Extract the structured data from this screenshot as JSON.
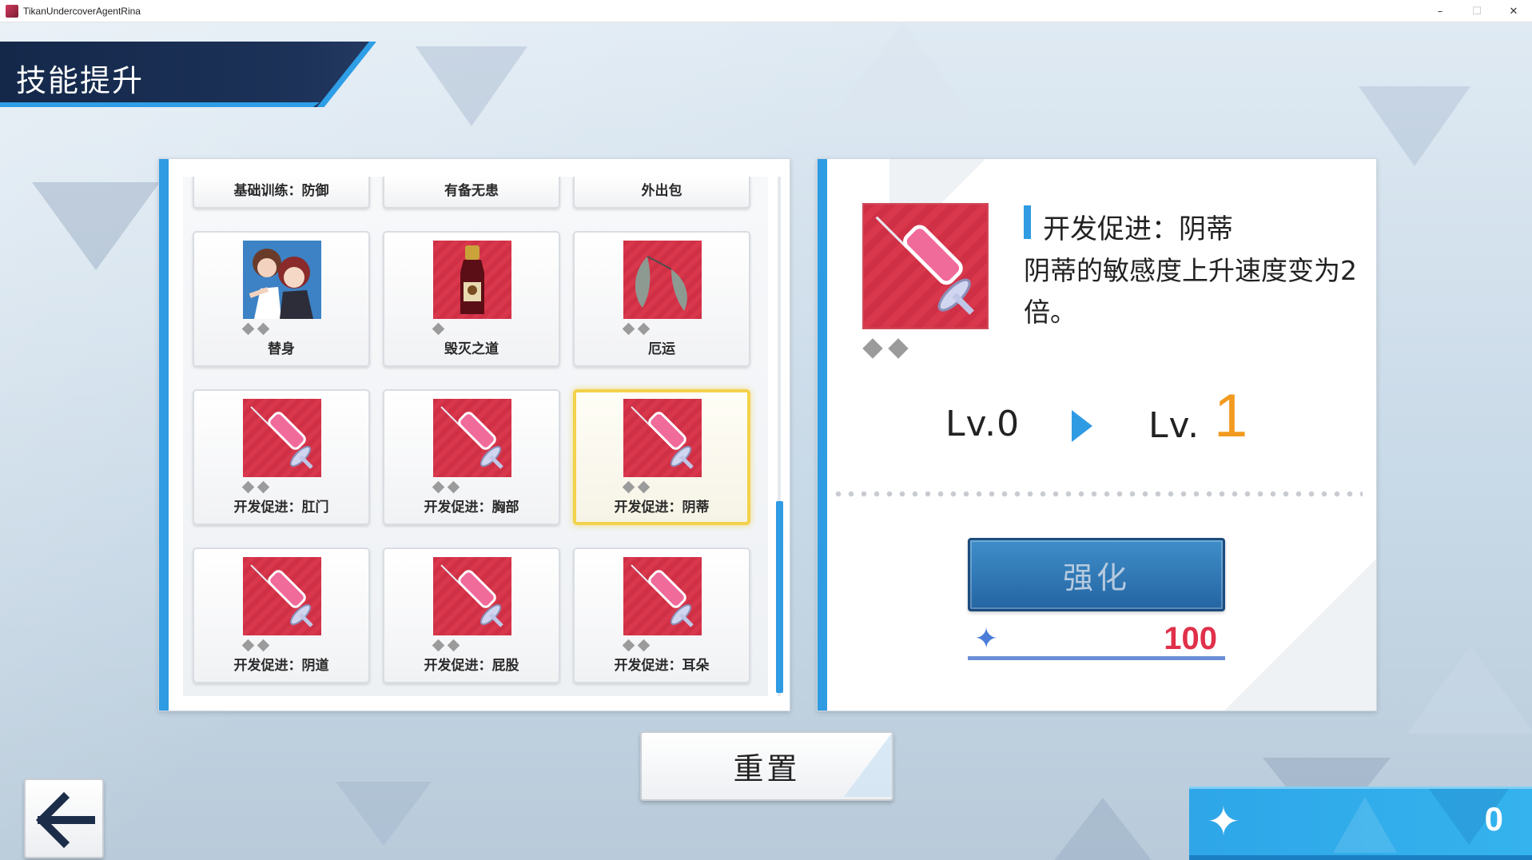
{
  "window": {
    "title": "TikanUndercoverAgentRina",
    "minimize": "–",
    "maximize": "☐",
    "close": "✕"
  },
  "header": {
    "title": "技能提升"
  },
  "skills_partial": [
    {
      "label": "基础训练：防御"
    },
    {
      "label": "有备无患"
    },
    {
      "label": "外出包"
    }
  ],
  "skills": [
    {
      "label": "替身",
      "icon": "characters-portrait",
      "pips": 2
    },
    {
      "label": "毁灭之道",
      "icon": "bottle-icon",
      "pips": 1
    },
    {
      "label": "厄运",
      "icon": "feathers-icon",
      "pips": 2
    },
    {
      "label": "开发促进：肛门",
      "icon": "syringe-icon",
      "pips": 2
    },
    {
      "label": "开发促进：胸部",
      "icon": "syringe-icon",
      "pips": 2
    },
    {
      "label": "开发促进：阴蒂",
      "icon": "syringe-icon",
      "pips": 2,
      "selected": true
    },
    {
      "label": "开发促进：阴道",
      "icon": "syringe-icon",
      "pips": 2
    },
    {
      "label": "开发促进：屁股",
      "icon": "syringe-icon",
      "pips": 2
    },
    {
      "label": "开发促进：耳朵",
      "icon": "syringe-icon",
      "pips": 2
    }
  ],
  "detail": {
    "icon": "syringe-icon",
    "pips": 2,
    "title": "开发促进：阴蒂",
    "description": "阴蒂的敏感度上升速度变为2倍。",
    "level_from": "Lv.0",
    "level_to_prefix": "Lv.",
    "level_to_value": "1",
    "enhance_label": "强化",
    "cost": "100"
  },
  "reset_label": "重置",
  "points": "0",
  "colors": {
    "accent": "#2f9be3",
    "header": "#14284a",
    "selected_border": "#f2d24c",
    "level_up": "#f29a1f",
    "cost": "#e0304a"
  }
}
